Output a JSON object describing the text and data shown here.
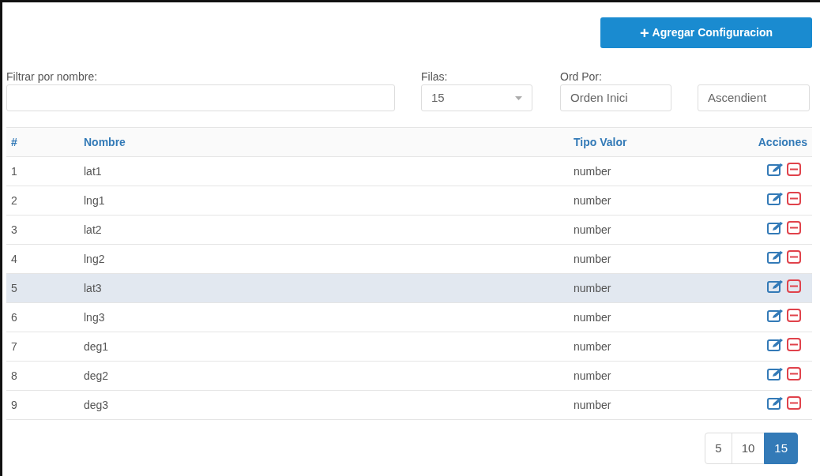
{
  "add_button": {
    "label": "Agregar Configuracion",
    "icon": "+"
  },
  "filters": {
    "name_label": "Filtrar por nombre:",
    "rows_label": "Filas:",
    "rows_value": "15",
    "order_label": "Ord Por:",
    "order_by": "Orden Inici",
    "direction": "Ascendient"
  },
  "table": {
    "columns": [
      "#",
      "Nombre",
      "Tipo Valor",
      "Acciones"
    ],
    "rows": [
      {
        "index": "1",
        "name": "lat1",
        "type": "number",
        "hovered": false
      },
      {
        "index": "2",
        "name": "lng1",
        "type": "number",
        "hovered": false
      },
      {
        "index": "3",
        "name": "lat2",
        "type": "number",
        "hovered": false
      },
      {
        "index": "4",
        "name": "lng2",
        "type": "number",
        "hovered": false
      },
      {
        "index": "5",
        "name": "lat3",
        "type": "number",
        "hovered": true
      },
      {
        "index": "6",
        "name": "lng3",
        "type": "number",
        "hovered": false
      },
      {
        "index": "7",
        "name": "deg1",
        "type": "number",
        "hovered": false
      },
      {
        "index": "8",
        "name": "deg2",
        "type": "number",
        "hovered": false
      },
      {
        "index": "9",
        "name": "deg3",
        "type": "number",
        "hovered": false
      }
    ]
  },
  "page_sizes": [
    {
      "label": "5",
      "selected": false
    },
    {
      "label": "10",
      "selected": false
    },
    {
      "label": "15",
      "selected": true
    }
  ]
}
